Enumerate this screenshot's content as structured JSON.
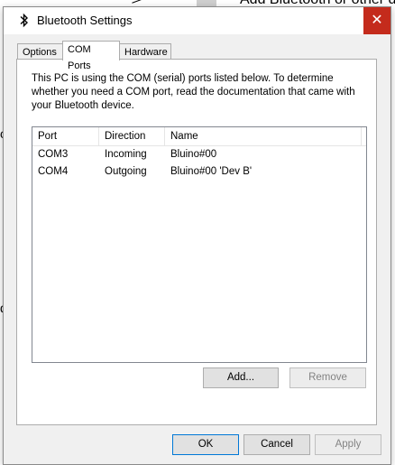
{
  "background": {
    "top_right_text": "Add Bluetooth or other de",
    "left_char_1": "c",
    "left_char_2": "d"
  },
  "window": {
    "title": "Bluetooth Settings",
    "icon": "bluetooth-icon",
    "close_label": "✕",
    "accent_close": "#c42b1c"
  },
  "tabs": [
    {
      "label": "Options",
      "active": false
    },
    {
      "label": "COM Ports",
      "active": true
    },
    {
      "label": "Hardware",
      "active": false
    }
  ],
  "com_ports": {
    "description": "This PC is using the COM (serial) ports listed below. To determine whether you need a COM port, read the documentation that came with your Bluetooth device.",
    "columns": [
      "Port",
      "Direction",
      "Name"
    ],
    "rows": [
      {
        "port": "COM3",
        "direction": "Incoming",
        "name": "Bluino#00"
      },
      {
        "port": "COM4",
        "direction": "Outgoing",
        "name": "Bluino#00 'Dev B'"
      }
    ],
    "add_label": "Add...",
    "remove_label": "Remove"
  },
  "footer": {
    "ok_label": "OK",
    "cancel_label": "Cancel",
    "apply_label": "Apply"
  }
}
